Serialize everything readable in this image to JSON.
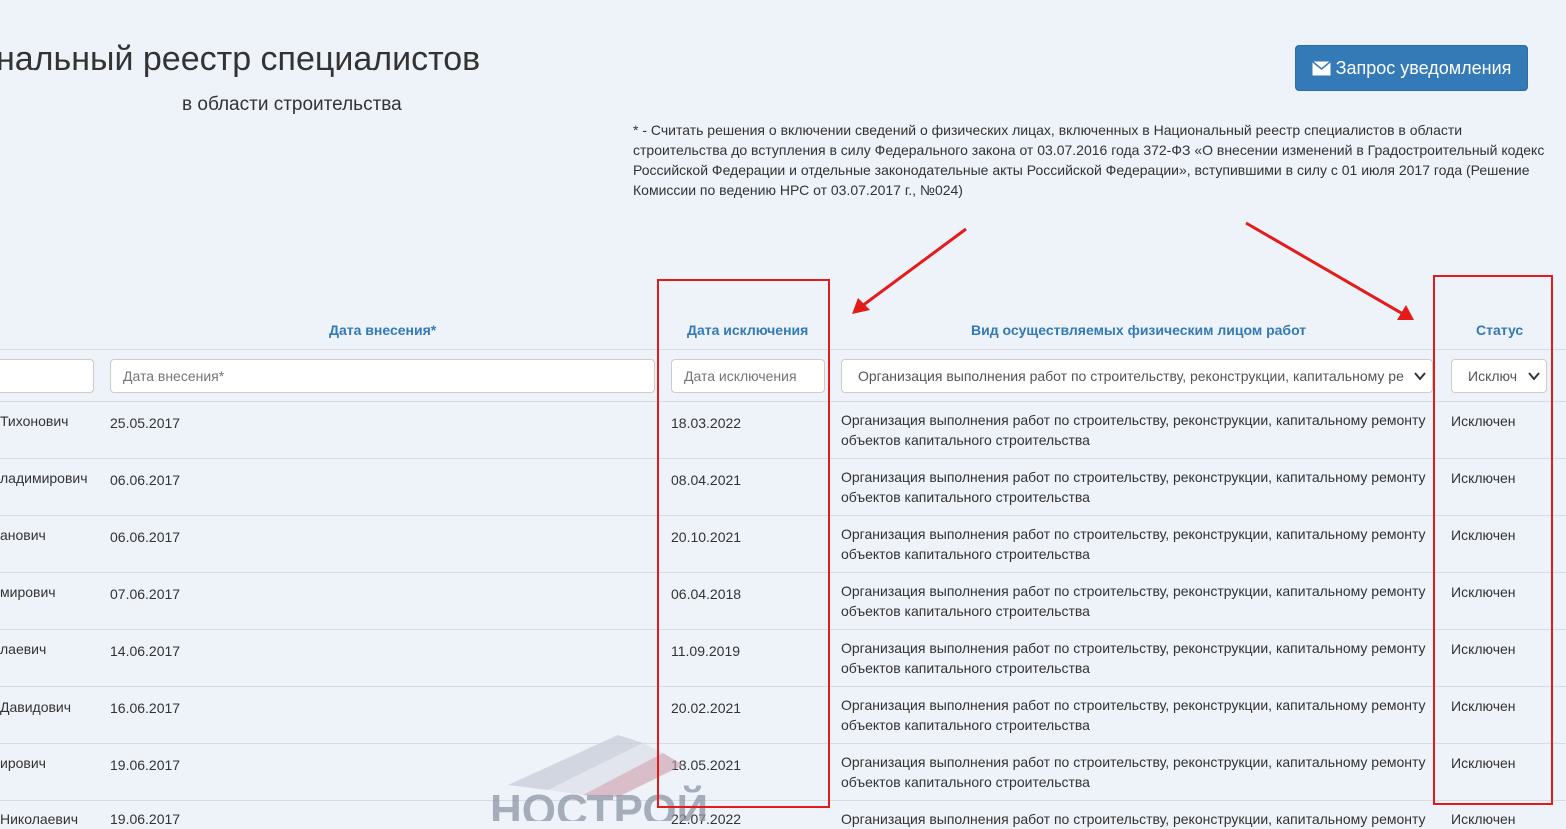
{
  "header": {
    "title": "нальный реестр специалистов",
    "subtitle": "в области строительства",
    "notify_button": "Запрос уведомления"
  },
  "footnote": "* - Считать решения о включении сведений о физических лицах, включенных в Национальный реестр специалистов в области строительства до вступления в силу Федерального закона от 03.07.2016 года 372-ФЗ «О внесении изменений в Градостроительный кодекс Российской Федерации и отдельные законодательные акты Российской Федерации», вступившими в силу с 01 июля 2017 года (Решение Комиссии по ведению НРС от 03.07.2017 г., №024)",
  "table": {
    "headers": {
      "date_added": "Дата внесения*",
      "date_excluded": "Дата исключения",
      "work_type": "Вид осуществляемых физическим лицом работ",
      "status": "Статус"
    },
    "filters": {
      "date_added_placeholder": "Дата внесения*",
      "date_excluded_placeholder": "Дата исключения",
      "work_type_value": "Организация выполнения работ по строительству, реконструкции, капитальному ре",
      "status_value": "Исключ"
    },
    "rows": [
      {
        "name": "Тихонович",
        "date_added": "25.05.2017",
        "date_excluded": "18.03.2022",
        "work": "Организация выполнения работ по строительству, реконструкции, капитальному ремонту объектов капитального строительства",
        "status": "Исключен"
      },
      {
        "name": "ладимирович",
        "date_added": "06.06.2017",
        "date_excluded": "08.04.2021",
        "work": "Организация выполнения работ по строительству, реконструкции, капитальному ремонту объектов капитального строительства",
        "status": "Исключен"
      },
      {
        "name": "анович",
        "date_added": "06.06.2017",
        "date_excluded": "20.10.2021",
        "work": "Организация выполнения работ по строительству, реконструкции, капитальному ремонту объектов капитального строительства",
        "status": "Исключен"
      },
      {
        "name": "мирович",
        "date_added": "07.06.2017",
        "date_excluded": "06.04.2018",
        "work": "Организация выполнения работ по строительству, реконструкции, капитальному ремонту объектов капитального строительства",
        "status": "Исключен"
      },
      {
        "name": "лаевич",
        "date_added": "14.06.2017",
        "date_excluded": "11.09.2019",
        "work": "Организация выполнения работ по строительству, реконструкции, капитальному ремонту объектов капитального строительства",
        "status": "Исключен"
      },
      {
        "name": "Давидович",
        "date_added": "16.06.2017",
        "date_excluded": "20.02.2021",
        "work": "Организация выполнения работ по строительству, реконструкции, капитальному ремонту объектов капитального строительства",
        "status": "Исключен"
      },
      {
        "name": "ирович",
        "date_added": "19.06.2017",
        "date_excluded": "18.05.2021",
        "work": "Организация выполнения работ по строительству, реконструкции, капитальному ремонту объектов капитального строительства",
        "status": "Исключен"
      },
      {
        "name": "Николаевич",
        "date_added": "19.06.2017",
        "date_excluded": "22.07.2022",
        "work": "Организация выполнения работ по строительству, реконструкции, капитальному ремонту",
        "status": "Исключен"
      }
    ]
  },
  "watermark": {
    "text": "НОСТРОЙ"
  },
  "colors": {
    "background": "#eef2f9",
    "link_blue": "#337ab7",
    "annotation_red": "#e41b1b"
  }
}
